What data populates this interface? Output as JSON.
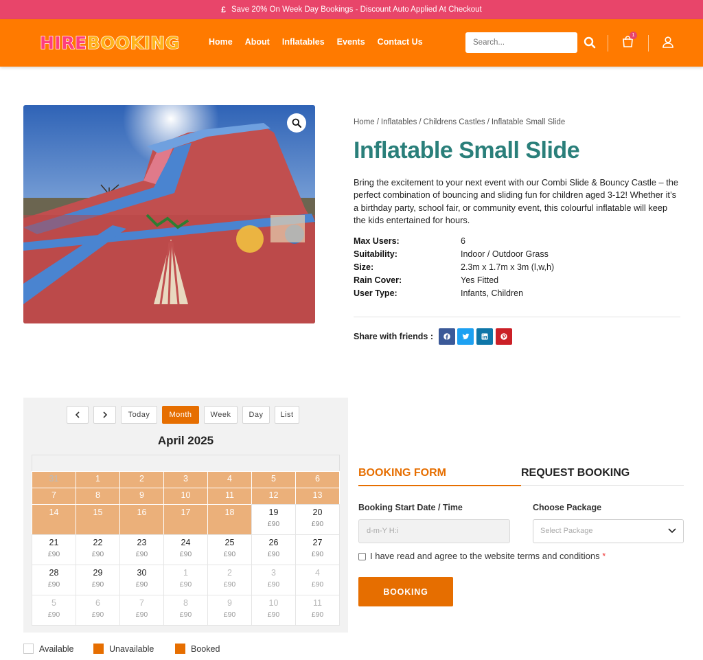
{
  "topbar": {
    "icon": "£",
    "text": "Save 20% On Week Day Bookings - Discount Auto Applied At Checkout"
  },
  "logo": {
    "part1": "HIRE",
    "part2": "BOOKING"
  },
  "nav": [
    "Home",
    "About",
    "Inflatables",
    "Events",
    "Contact Us"
  ],
  "search": {
    "placeholder": "Search..."
  },
  "cart": {
    "count": "1"
  },
  "colors": {
    "topbar": "#e8456a",
    "header": "#ff7a00",
    "title": "#2a7f7a",
    "accent": "#e66e00",
    "unavailable": "#ebb07a"
  },
  "breadcrumb": [
    "Home",
    "Inflatables",
    "Childrens Castles",
    "Inflatable Small Slide"
  ],
  "product": {
    "title": "Inflatable Small Slide",
    "description": "Bring the excitement to your next event with our Combi Slide & Bouncy Castle – the perfect combination of bouncing and sliding fun for children aged 3-12! Whether it’s a birthday party, school fair, or community event, this colourful inflatable will keep the kids entertained for hours.",
    "specs": [
      {
        "key": "Max Users:",
        "value": "6"
      },
      {
        "key": "Suitability:",
        "value": "Indoor / Outdoor Grass"
      },
      {
        "key": "Size:",
        "value": "2.3m x 1.7m x 3m (l,w,h)"
      },
      {
        "key": "Rain Cover:",
        "value": "Yes Fitted"
      },
      {
        "key": "User Type:",
        "value": "Infants, Children"
      }
    ],
    "share_label": "Share with friends :"
  },
  "share_icons": [
    "facebook-icon",
    "twitter-icon",
    "linkedin-icon",
    "pinterest-icon"
  ],
  "calendar": {
    "buttons": [
      "Today",
      "Month",
      "Week",
      "Day",
      "List"
    ],
    "active": "Month",
    "title": "April 2025",
    "rows": [
      [
        {
          "d": "31",
          "s": "un",
          "m": true
        },
        {
          "d": "1",
          "s": "un"
        },
        {
          "d": "2",
          "s": "un"
        },
        {
          "d": "3",
          "s": "un"
        },
        {
          "d": "4",
          "s": "un"
        },
        {
          "d": "5",
          "s": "un"
        },
        {
          "d": "6",
          "s": "un"
        }
      ],
      [
        {
          "d": "7",
          "s": "un"
        },
        {
          "d": "8",
          "s": "un"
        },
        {
          "d": "9",
          "s": "un"
        },
        {
          "d": "10",
          "s": "un"
        },
        {
          "d": "11",
          "s": "un"
        },
        {
          "d": "12",
          "s": "un"
        },
        {
          "d": "13",
          "s": "un"
        }
      ],
      [
        {
          "d": "14",
          "s": "un"
        },
        {
          "d": "15",
          "s": "un"
        },
        {
          "d": "16",
          "s": "un"
        },
        {
          "d": "17",
          "s": "un"
        },
        {
          "d": "18",
          "s": "un"
        },
        {
          "d": "19",
          "p": "£90"
        },
        {
          "d": "20",
          "p": "£90"
        }
      ],
      [
        {
          "d": "21",
          "p": "£90"
        },
        {
          "d": "22",
          "p": "£90"
        },
        {
          "d": "23",
          "p": "£90"
        },
        {
          "d": "24",
          "p": "£90"
        },
        {
          "d": "25",
          "p": "£90"
        },
        {
          "d": "26",
          "p": "£90"
        },
        {
          "d": "27",
          "p": "£90"
        }
      ],
      [
        {
          "d": "28",
          "p": "£90"
        },
        {
          "d": "29",
          "p": "£90"
        },
        {
          "d": "30",
          "p": "£90"
        },
        {
          "d": "1",
          "p": "£90",
          "m": true
        },
        {
          "d": "2",
          "p": "£90",
          "m": true
        },
        {
          "d": "3",
          "p": "£90",
          "m": true
        },
        {
          "d": "4",
          "p": "£90",
          "m": true
        }
      ],
      [
        {
          "d": "5",
          "p": "£90",
          "m": true
        },
        {
          "d": "6",
          "p": "£90",
          "m": true
        },
        {
          "d": "7",
          "p": "£90",
          "m": true
        },
        {
          "d": "8",
          "p": "£90",
          "m": true
        },
        {
          "d": "9",
          "p": "£90",
          "m": true
        },
        {
          "d": "10",
          "p": "£90",
          "m": true
        },
        {
          "d": "11",
          "p": "£90",
          "m": true
        }
      ]
    ],
    "legend": [
      {
        "label": "Available",
        "color": "#ffffff"
      },
      {
        "label": "Unavailable",
        "color": "#e66e00"
      },
      {
        "label": "Booked",
        "color": "#e66e00"
      }
    ]
  },
  "booking": {
    "tabs": [
      "BOOKING FORM",
      "REQUEST BOOKING"
    ],
    "start_label": "Booking Start Date / Time",
    "start_placeholder": "d-m-Y H:i",
    "package_label": "Choose Package",
    "package_placeholder": "Select Package",
    "terms": "I have read and agree to the website terms and conditions",
    "required_mark": "*",
    "submit": "BOOKING"
  }
}
